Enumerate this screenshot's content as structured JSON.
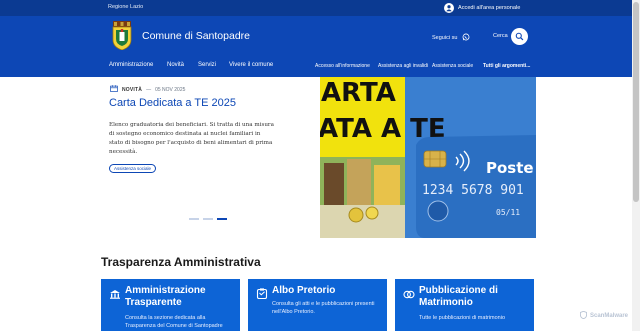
{
  "slim_header": {
    "region_label": "Regione Lazio",
    "login_label": "Accedi all'area personale"
  },
  "header": {
    "site_title": "Comune di Santopadre",
    "follow_label": "Seguici su",
    "search_label": "Cerca"
  },
  "nav": {
    "main_items": [
      "Amministrazione",
      "Novità",
      "Servizi",
      "Vivere il comune"
    ],
    "secondary_items": [
      "Accesso all'informazione",
      "Assistenza agli invalidi",
      "Assistenza sociale",
      "Tutti gli argomenti..."
    ]
  },
  "hero": {
    "category": "NOVITÀ",
    "separator": "—",
    "date": "05 NOV 2025",
    "title": "Carta Dedicata a TE 2025",
    "text": "Elenco graduatoria dei beneficiari. Si tratta di una misura di sostegno economico destinata ai nuclei familiari in stato di bisogno per l'acquisto di beni alimentari di prima necessità.",
    "tag": "Assistenza sociale",
    "image_text": {
      "line1": "ARTA",
      "line2": "ATA A TE",
      "card_brand": "Poste",
      "card_number": "1234 5678 901",
      "card_expiry": "05/11"
    },
    "carousel_active_index": 2,
    "carousel_count": 3
  },
  "section": {
    "title": "Trasparenza Amministrativa",
    "cards": [
      {
        "title_line1": "Amministrazione",
        "title_line2": "Trasparente",
        "text_line1": "Consulta la sezione dedicata alla",
        "text_line2": "Trasparenza del Comune di Santopadre"
      },
      {
        "title_line1": "Albo Pretorio",
        "title_line2": "",
        "text_line1": "Consulta gli atti e le pubblicazioni presenti",
        "text_line2": "nell'Albo Pretorio."
      },
      {
        "title_line1": "Pubblicazione di",
        "title_line2": "Matrimonio",
        "text_line1": "Tutte le pubblicazioni di matrimonio",
        "text_line2": ""
      }
    ]
  },
  "watermark": "ScanMalware",
  "colors": {
    "primary": "#0d47b5",
    "slim": "#0b3a92",
    "card": "#0d64d6",
    "image_yellow": "#f1e20d"
  },
  "icons": [
    "user-icon",
    "whatsapp-icon",
    "search-icon",
    "calendar-icon",
    "building-icon",
    "clipboard-icon",
    "rings-icon",
    "shield-icon"
  ]
}
